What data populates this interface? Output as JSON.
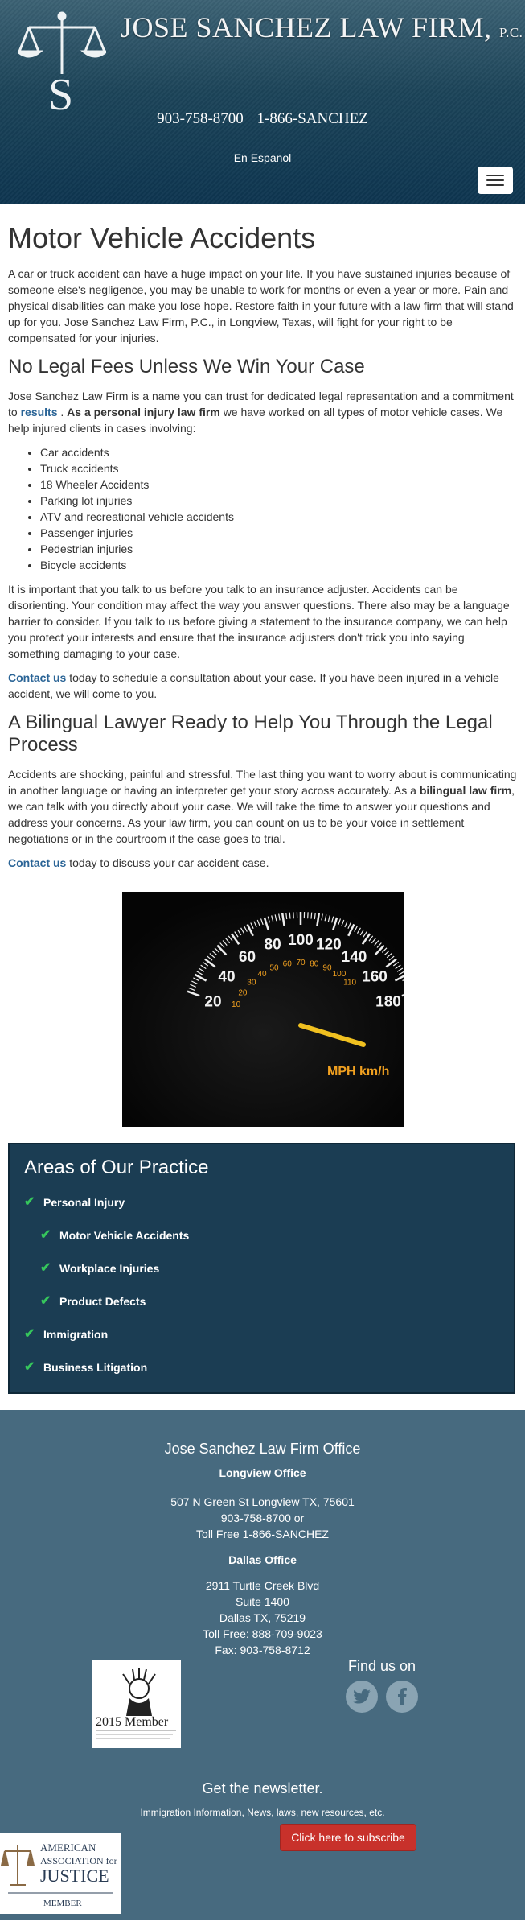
{
  "header": {
    "firm_name": "JOSE SANCHEZ LAW FIRM,",
    "firm_suffix": "P.C.",
    "phone_1": "903-758-8700",
    "phone_2": "1-866-SANCHEZ",
    "espanol": "En Espanol",
    "menu_icon": "hamburger-icon"
  },
  "main": {
    "title": "Motor Vehicle Accidents",
    "intro": "A car or truck accident can have a huge impact on your life. If you have sustained injuries because of someone else's negligence, you may be unable to work for months or even a year or more. Pain and physical disabilities can make you lose hope. Restore faith in your future with a law firm that will stand up for you. Jose Sanchez Law Firm, P.C., in Longview, Texas, will fight for your right to be compensated for your injuries.",
    "section1_title": "No Legal Fees Unless We Win Your Case",
    "s1_p1_a": "Jose Sanchez Law Firm is a name you can trust for dedicated legal representation and a commitment to",
    "s1_p1_link": "results",
    "s1_p1_b": ".",
    "s1_p1_bold": "As a personal injury law firm",
    "s1_p1_c": "we have worked on all types of motor vehicle cases. We help injured clients in cases involving:",
    "cases": [
      "Car accidents",
      "Truck accidents",
      "18 Wheeler Accidents",
      "Parking lot injuries",
      "ATV and recreational vehicle accidents",
      "Passenger injuries",
      "Pedestrian injuries",
      "Bicycle accidents"
    ],
    "s1_p2": "It is important that you talk to us before you talk to an insurance adjuster. Accidents can be disorienting. Your condition may affect the way you answer questions. There also may be a language barrier to consider. If you talk to us before giving a statement to the insurance company, we can help you protect your interests and ensure that the insurance adjusters don't trick you into saying something damaging to your case.",
    "s1_p3_link": "Contact us",
    "s1_p3_rest": "today to schedule a consultation about your case. If you have been injured in a vehicle accident, we will come to you.",
    "section2_title": "A Bilingual Lawyer Ready to Help You Through the Legal Process",
    "s2_p1_a": "Accidents are shocking, painful and stressful. The last thing you want to worry about is communicating in another language or having an interpreter get your story across accurately. As a",
    "s2_p1_bold": "bilingual law firm",
    "s2_p1_b": ", we can talk with you directly about your case. We will take the time to answer your questions and address your concerns. As your law firm, you can count on us to be your voice in settlement negotiations or in the courtroom if the case goes to trial.",
    "s2_p2_link": "Contact us",
    "s2_p2_rest": "today to discuss your car accident case.",
    "speedo": {
      "ticks_mph": [
        "20",
        "40",
        "60",
        "80",
        "100",
        "120",
        "140",
        "160",
        "180"
      ],
      "ticks_kmh": [
        "10",
        "20",
        "30",
        "40",
        "50",
        "60",
        "70",
        "80",
        "90",
        "100",
        "110"
      ],
      "unit": "MPH km/h"
    }
  },
  "practice": {
    "title": "Areas of Our Practice",
    "items": [
      {
        "label": "Personal Injury",
        "sub": false
      },
      {
        "label": "Motor Vehicle Accidents",
        "sub": true
      },
      {
        "label": "Workplace Injuries",
        "sub": true
      },
      {
        "label": "Product Defects",
        "sub": true
      },
      {
        "label": "Immigration",
        "sub": false
      },
      {
        "label": "Business Litigation",
        "sub": false
      }
    ]
  },
  "footer": {
    "title": "Jose Sanchez Law Firm Office",
    "office1_name": "Longview Office",
    "office1_addr": "507 N Green St Longview TX, 75601",
    "office1_phone": "903-758-8700 or",
    "office1_toll": "Toll Free 1-866-SANCHEZ",
    "office2_name": "Dallas Office",
    "office2_addr1": "2911 Turtle Creek Blvd",
    "office2_addr2": "Suite 1400",
    "office2_addr3": "Dallas TX, 75219",
    "office2_toll": "Toll Free: 888-709-9023",
    "office2_fax": "Fax: 903-758-8712",
    "member_badge": "2015 Member",
    "findus": "Find us on",
    "newsletter_title": "Get the newsletter.",
    "newsletter_sub": "Immigration Information, News, laws, new resources, etc.",
    "subscribe_label": "Click here to subscribe",
    "aaj_line1": "AMERICAN",
    "aaj_line2": "ASSOCIATION for",
    "aaj_line3": "JUSTICE",
    "aaj_line4": "MEMBER"
  }
}
